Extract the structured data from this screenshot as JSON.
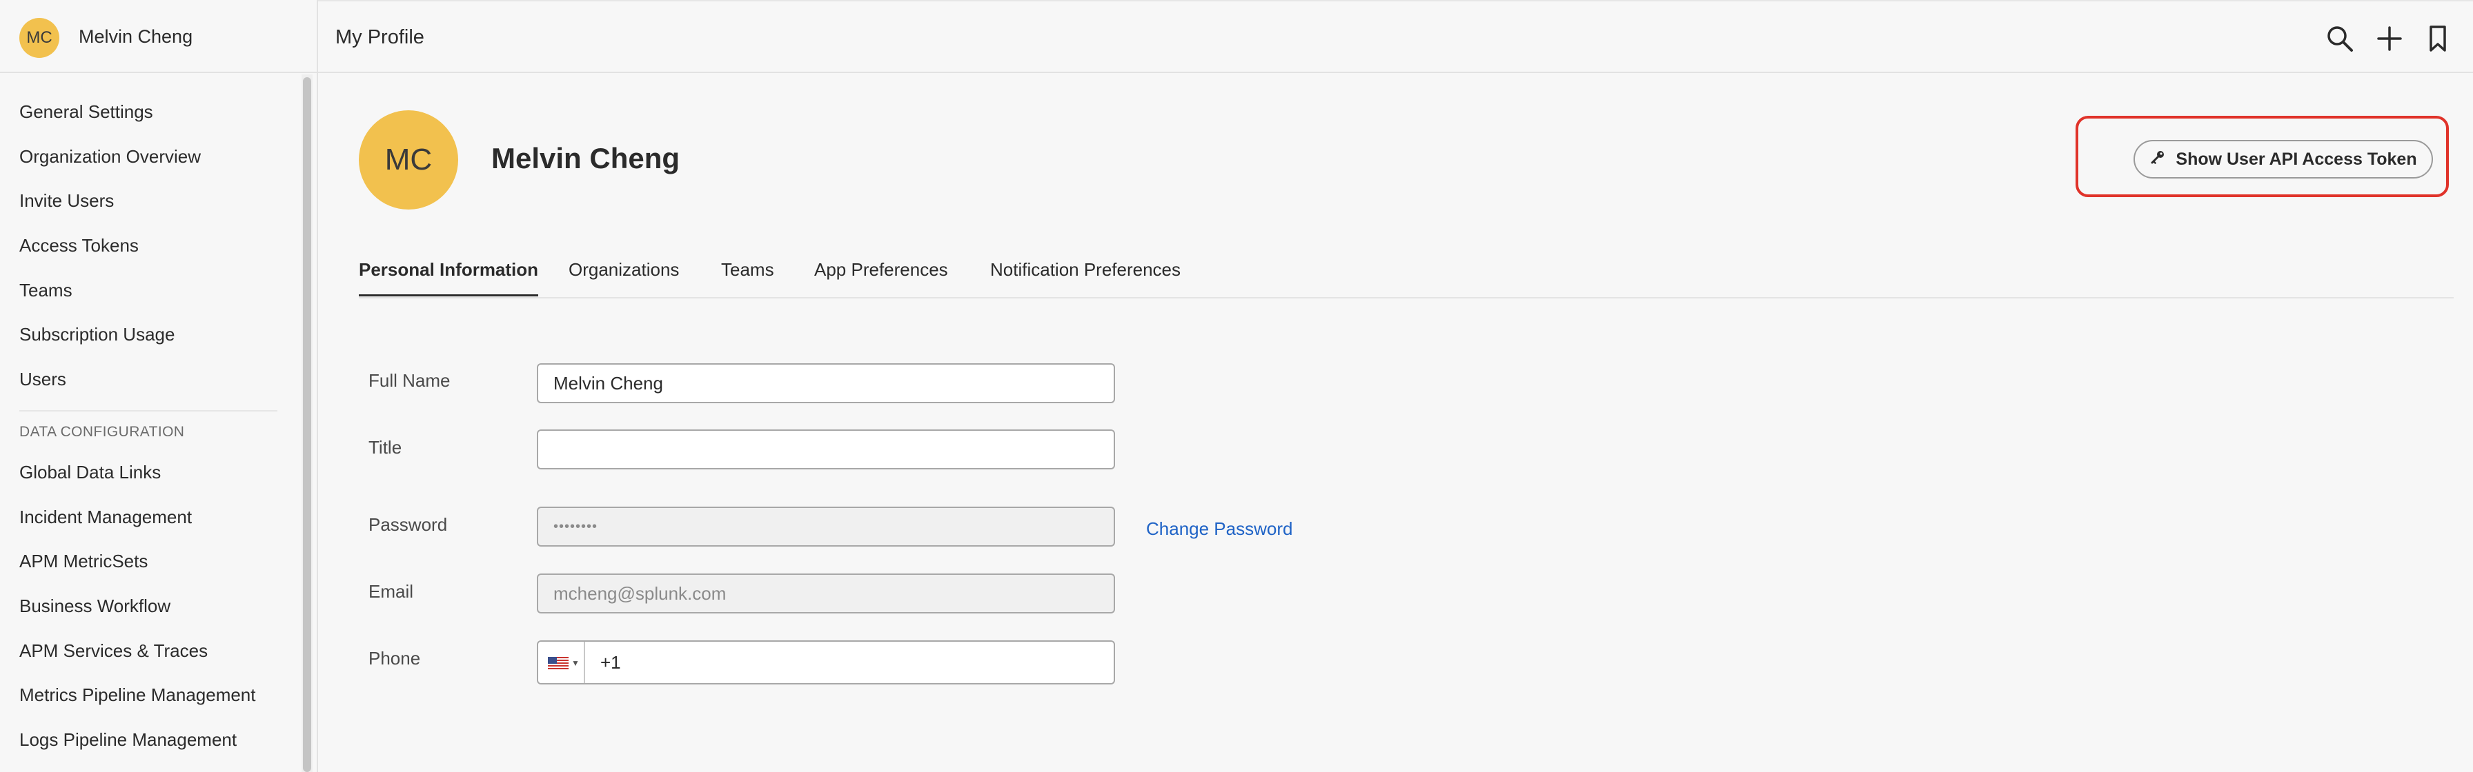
{
  "user": {
    "initials": "MC",
    "name": "Melvin Cheng"
  },
  "sidebar": {
    "items": [
      {
        "label": "General Settings"
      },
      {
        "label": "Organization Overview"
      },
      {
        "label": "Invite Users"
      },
      {
        "label": "Access Tokens"
      },
      {
        "label": "Teams"
      },
      {
        "label": "Subscription Usage"
      },
      {
        "label": "Users"
      }
    ],
    "section_label": "DATA CONFIGURATION",
    "section_items": [
      {
        "label": "Global Data Links"
      },
      {
        "label": "Incident Management"
      },
      {
        "label": "APM MetricSets"
      },
      {
        "label": "Business Workflow"
      },
      {
        "label": "APM Services & Traces"
      },
      {
        "label": "Metrics Pipeline Management"
      },
      {
        "label": "Logs Pipeline Management"
      }
    ]
  },
  "header": {
    "title": "My Profile",
    "icons": [
      "search-icon",
      "plus-icon",
      "bookmark-icon"
    ]
  },
  "profile": {
    "token_button_label": "Show User API Access Token",
    "highlight_color": "#e0332a"
  },
  "tabs": [
    {
      "label": "Personal Information",
      "active": true
    },
    {
      "label": "Organizations"
    },
    {
      "label": "Teams"
    },
    {
      "label": "App Preferences"
    },
    {
      "label": "Notification Preferences"
    }
  ],
  "form": {
    "full_name_label": "Full Name",
    "full_name_value": "Melvin Cheng",
    "title_label": "Title",
    "title_value": "",
    "password_label": "Password",
    "password_value": "••••••••",
    "change_password_label": "Change Password",
    "email_label": "Email",
    "email_value": "mcheng@splunk.com",
    "phone_label": "Phone",
    "phone_value": "+1",
    "phone_country": "US"
  }
}
